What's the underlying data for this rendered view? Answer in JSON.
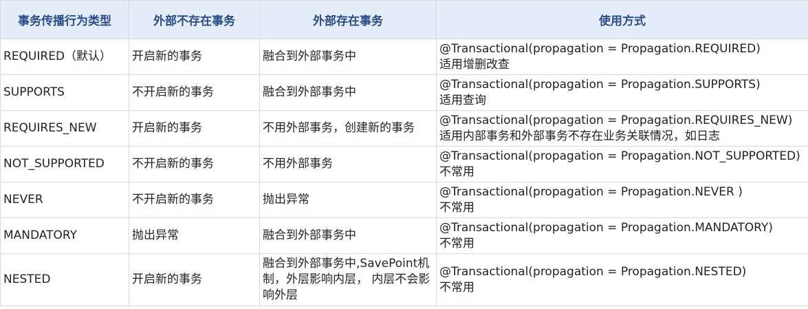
{
  "table": {
    "headers": [
      "事务传播行为类型",
      "外部不存在事务",
      "外部存在事务",
      "使用方式"
    ],
    "rows": [
      {
        "type": "REQUIRED（默认）",
        "no_outer": "开启新的事务",
        "with_outer": "融合到外部事务中",
        "usage_code": "@Transactional(propagation = Propagation.REQUIRED)",
        "usage_note": "适用增删改查"
      },
      {
        "type": "SUPPORTS",
        "no_outer": "不开启新的事务",
        "with_outer": "融合到外部事务中",
        "usage_code": "@Transactional(propagation = Propagation.SUPPORTS)",
        "usage_note": "适用查询"
      },
      {
        "type": "REQUIRES_NEW",
        "no_outer": "开启新的事务",
        "with_outer": "不用外部事务，创建新的事务",
        "usage_code": "@Transactional(propagation = Propagation.REQUIRES_NEW)",
        "usage_note": "适用内部事务和外部事务不存在业务关联情况，如日志"
      },
      {
        "type": "NOT_SUPPORTED",
        "no_outer": "不开启新的事务",
        "with_outer": "不用外部事务",
        "usage_code": "@Transactional(propagation = Propagation.NOT_SUPPORTED)",
        "usage_note": "不常用"
      },
      {
        "type": "NEVER",
        "no_outer": "不开启新的事务",
        "with_outer": "抛出异常",
        "usage_code": "@Transactional(propagation = Propagation.NEVER )",
        "usage_note": "不常用"
      },
      {
        "type": "MANDATORY",
        "no_outer": "抛出异常",
        "with_outer": "融合到外部事务中",
        "usage_code": "@Transactional(propagation = Propagation.MANDATORY)",
        "usage_note": "不常用"
      },
      {
        "type": "NESTED",
        "no_outer": "开启新的事务",
        "with_outer": "融合到外部事务中,SavePoint机制，外层影响内层， 内层不会影响外层",
        "usage_code": "@Transactional(propagation = Propagation.NESTED)",
        "usage_note": "不常用"
      }
    ]
  }
}
